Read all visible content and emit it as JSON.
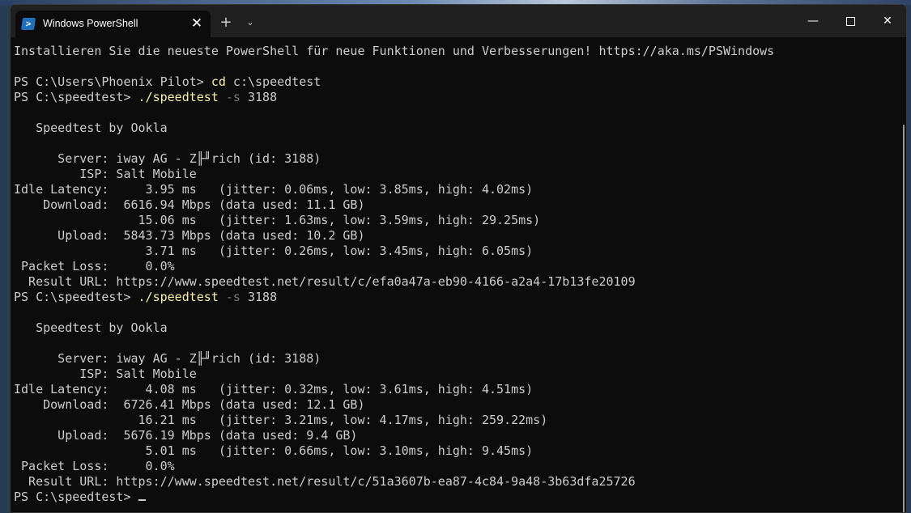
{
  "window": {
    "tab_title": "Windows PowerShell",
    "tab_icon": "powershell-icon",
    "close_tab": "✕",
    "new_tab": "+",
    "dropdown": "⌄",
    "minimize": "—",
    "close": "✕"
  },
  "terminal": {
    "lines": [
      [
        {
          "t": "Installieren Sie die neueste PowerShell für neue Funktionen und Verbesserungen! https://aka.ms/PSWindows"
        }
      ],
      [
        {
          "t": ""
        }
      ],
      [
        {
          "t": "PS C:\\Users\\Phoenix Pilot> "
        },
        {
          "t": "cd",
          "c": "cmd"
        },
        {
          "t": " c:\\speedtest"
        }
      ],
      [
        {
          "t": "PS C:\\speedtest> "
        },
        {
          "t": "./speedtest",
          "c": "cmd"
        },
        {
          "t": " -s",
          "c": "param"
        },
        {
          "t": " 3188"
        }
      ],
      [
        {
          "t": ""
        }
      ],
      [
        {
          "t": "   Speedtest by Ookla"
        }
      ],
      [
        {
          "t": ""
        }
      ],
      [
        {
          "t": "      Server: iway AG - Z╟╜rich (id: 3188)"
        }
      ],
      [
        {
          "t": "         ISP: Salt Mobile"
        }
      ],
      [
        {
          "t": "Idle Latency:     3.95 ms   (jitter: 0.06ms, low: 3.85ms, high: 4.02ms)"
        }
      ],
      [
        {
          "t": "    Download:  6616.94 Mbps (data used: 11.1 GB)"
        }
      ],
      [
        {
          "t": "                 15.06 ms   (jitter: 1.63ms, low: 3.59ms, high: 29.25ms)"
        }
      ],
      [
        {
          "t": "      Upload:  5843.73 Mbps (data used: 10.2 GB)"
        }
      ],
      [
        {
          "t": "                  3.71 ms   (jitter: 0.26ms, low: 3.45ms, high: 6.05ms)"
        }
      ],
      [
        {
          "t": " Packet Loss:     0.0%"
        }
      ],
      [
        {
          "t": "  Result URL: https://www.speedtest.net/result/c/efa0a47a-eb90-4166-a2a4-17b13fe20109"
        }
      ],
      [
        {
          "t": "PS C:\\speedtest> "
        },
        {
          "t": "./speedtest",
          "c": "cmd"
        },
        {
          "t": " -s",
          "c": "param"
        },
        {
          "t": " 3188"
        }
      ],
      [
        {
          "t": ""
        }
      ],
      [
        {
          "t": "   Speedtest by Ookla"
        }
      ],
      [
        {
          "t": ""
        }
      ],
      [
        {
          "t": "      Server: iway AG - Z╟╜rich (id: 3188)"
        }
      ],
      [
        {
          "t": "         ISP: Salt Mobile"
        }
      ],
      [
        {
          "t": "Idle Latency:     4.08 ms   (jitter: 0.32ms, low: 3.61ms, high: 4.51ms)"
        }
      ],
      [
        {
          "t": "    Download:  6726.41 Mbps (data used: 12.1 GB)"
        }
      ],
      [
        {
          "t": "                 16.21 ms   (jitter: 3.21ms, low: 4.17ms, high: 259.22ms)"
        }
      ],
      [
        {
          "t": "      Upload:  5676.19 Mbps (data used: 9.4 GB)"
        }
      ],
      [
        {
          "t": "                  5.01 ms   (jitter: 0.66ms, low: 3.10ms, high: 9.45ms)"
        }
      ],
      [
        {
          "t": " Packet Loss:     0.0%"
        }
      ],
      [
        {
          "t": "  Result URL: https://www.speedtest.net/result/c/51a3607b-ea87-4c84-9a48-3b63dfa25726"
        }
      ],
      [
        {
          "t": "PS C:\\speedtest> "
        }
      ]
    ]
  }
}
